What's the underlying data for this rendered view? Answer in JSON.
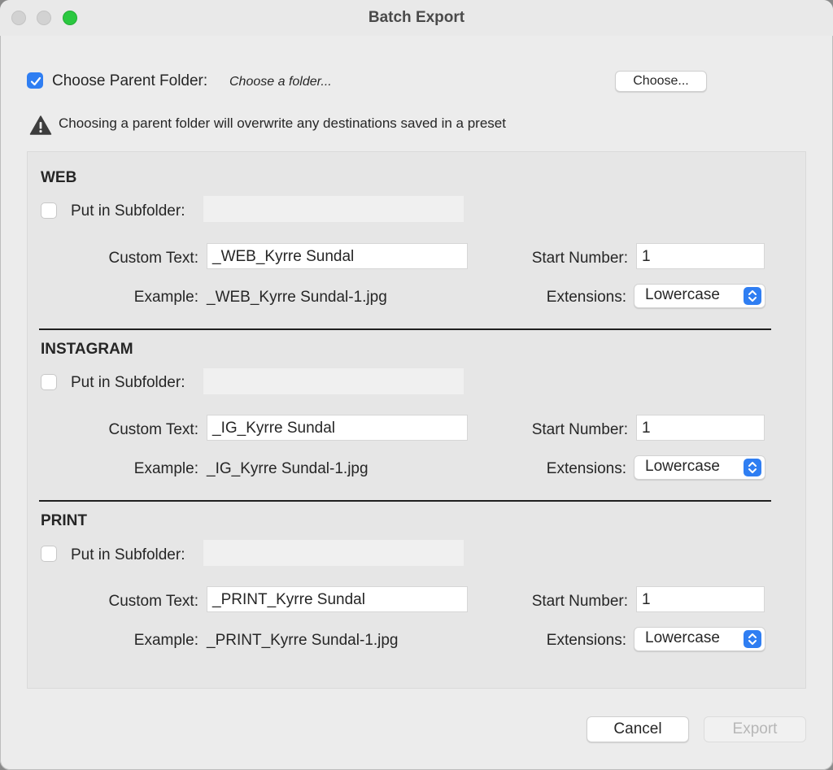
{
  "window": {
    "title": "Batch Export"
  },
  "parent_folder": {
    "checked": true,
    "label": "Choose Parent Folder:",
    "path": "Choose a folder...",
    "choose_button": "Choose..."
  },
  "warning": "Choosing a parent folder will overwrite any destinations saved in a preset",
  "sections": [
    {
      "title": "WEB",
      "subfolder_label": "Put in Subfolder:",
      "custom_text_label": "Custom Text:",
      "custom_text": "_WEB_Kyrre Sundal",
      "start_number_label": "Start Number:",
      "start_number": "1",
      "example_label": "Example:",
      "example": "_WEB_Kyrre Sundal-1.jpg",
      "extensions_label": "Extensions:",
      "extensions": "Lowercase"
    },
    {
      "title": "INSTAGRAM",
      "subfolder_label": "Put in Subfolder:",
      "custom_text_label": "Custom Text:",
      "custom_text": "_IG_Kyrre Sundal",
      "start_number_label": "Start Number:",
      "start_number": "1",
      "example_label": "Example:",
      "example": "_IG_Kyrre Sundal-1.jpg",
      "extensions_label": "Extensions:",
      "extensions": "Lowercase"
    },
    {
      "title": "PRINT",
      "subfolder_label": "Put in Subfolder:",
      "custom_text_label": "Custom Text:",
      "custom_text": "_PRINT_Kyrre Sundal",
      "start_number_label": "Start Number:",
      "start_number": "1",
      "example_label": "Example:",
      "example": "_PRINT_Kyrre Sundal-1.jpg",
      "extensions_label": "Extensions:",
      "extensions": "Lowercase"
    }
  ],
  "footer": {
    "cancel": "Cancel",
    "export": "Export"
  },
  "colors": {
    "accent": "#2f7ef2",
    "zoom_button": "#2bc840"
  }
}
